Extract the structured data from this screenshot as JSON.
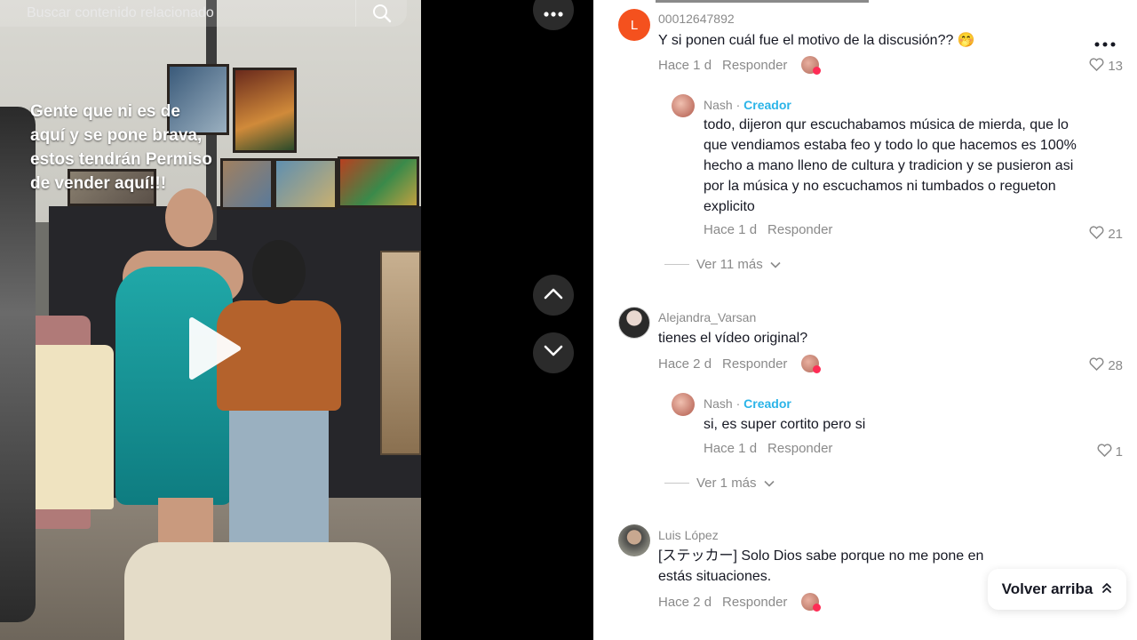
{
  "search": {
    "placeholder": "Buscar contenido relacionado",
    "icon": "search-icon"
  },
  "video": {
    "overlay_lines": [
      "Gente que ni es de",
      "aquí y se pone brava,",
      "estos tendrán Permiso",
      "de vender aquí!!!"
    ]
  },
  "controls": {
    "more_icon": "more-dots-icon",
    "up_icon": "chevron-up-icon",
    "down_icon": "chevron-down-icon"
  },
  "comments": [
    {
      "username": "00012647892",
      "avatar_letter": "L",
      "avatar_color": "#f4511e",
      "text": "Y si ponen cuál fue el motivo de la discusión?? 🤭",
      "time": "Hace 1 d",
      "reply_label": "Responder",
      "likes": "13"
    },
    {
      "username": "Nash",
      "creator_label": "Creador",
      "text": "todo, dijeron qur escuchabamos música de mierda, que lo que vendiamos estaba feo y todo lo que hacemos es 100% hecho a mano lleno de cultura y tradicion y se pusieron asi por la música y no escuchamos ni tumbados o regueton explicito",
      "time": "Hace 1 d",
      "reply_label": "Responder",
      "likes": "21"
    },
    {
      "more_replies": "Ver 11 más"
    },
    {
      "username": "Alejandra_Varsan",
      "text": "tienes el vídeo original?",
      "time": "Hace 2 d",
      "reply_label": "Responder",
      "likes": "28"
    },
    {
      "username": "Nash",
      "creator_label": "Creador",
      "text": "si, es super cortito pero si",
      "time": "Hace 1 d",
      "reply_label": "Responder",
      "likes": "1"
    },
    {
      "more_replies": "Ver 1 más"
    },
    {
      "username": "Luis López",
      "text": "[ステッカー] Solo Dios sabe porque no me pone en estás situaciones.",
      "time": "Hace 2 d",
      "reply_label": "Responder"
    }
  ],
  "back_to_top": {
    "label": "Volver arriba",
    "icon": "double-chevron-up-icon"
  }
}
